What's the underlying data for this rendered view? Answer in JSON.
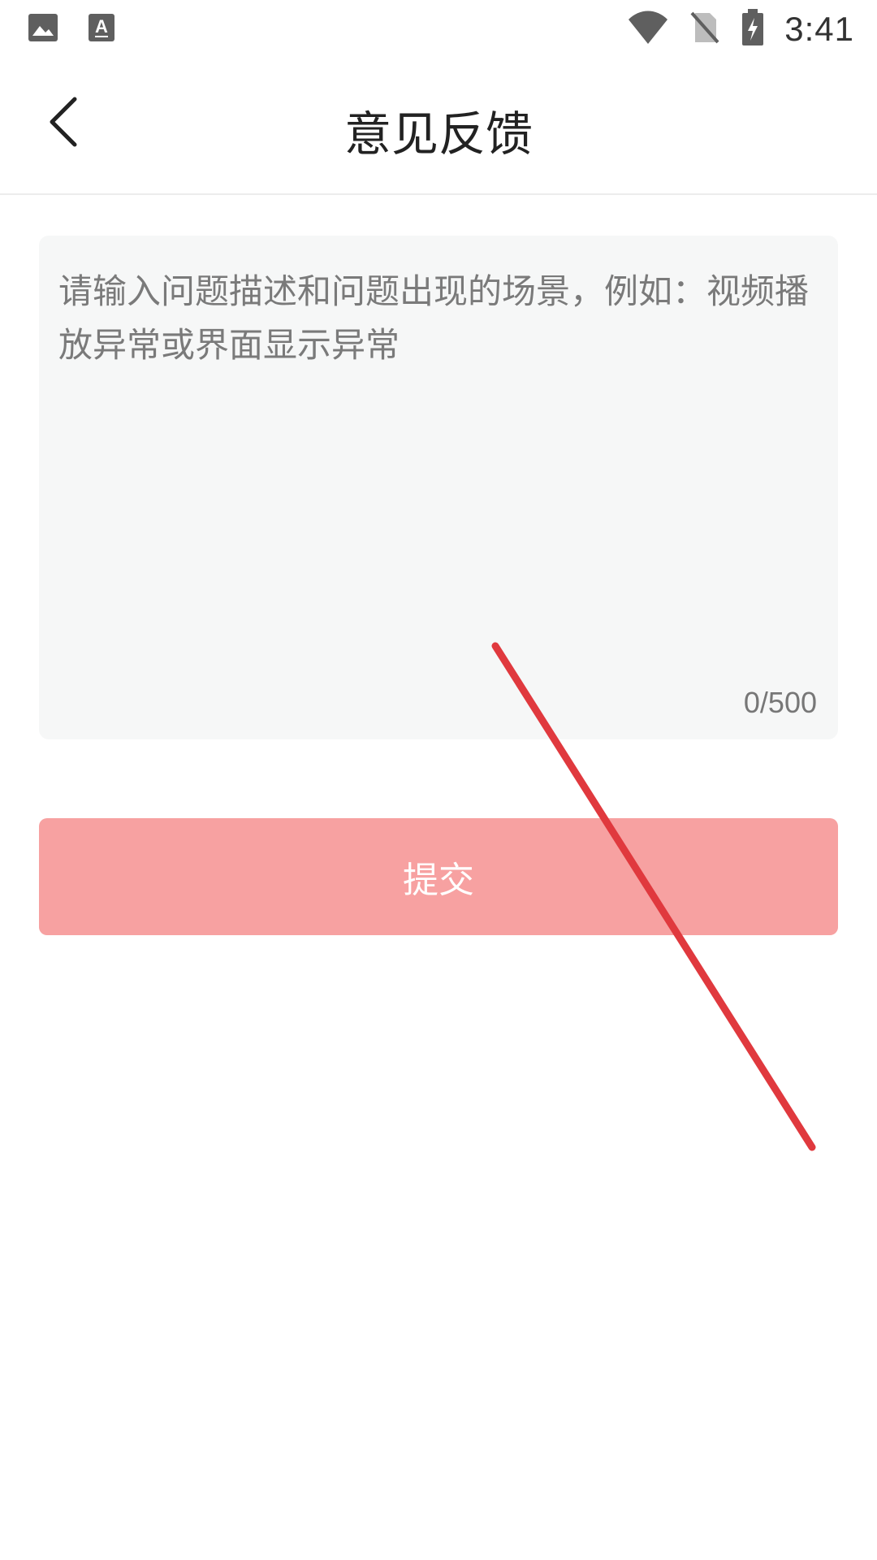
{
  "status_bar": {
    "time": "3:41",
    "icons": [
      "image-icon",
      "font-icon",
      "wifi-icon",
      "no-sim-icon",
      "battery-charging-icon"
    ]
  },
  "app_bar": {
    "title": "意见反馈",
    "back_icon": "back-arrow-icon"
  },
  "feedback": {
    "value": "",
    "placeholder": "请输入问题描述和问题出现的场景，例如：视频播放异常或界面显示异常",
    "counter": "0/500"
  },
  "submit": {
    "label": "提交",
    "color": "#f7a1a1"
  },
  "colors": {
    "annotation_line": "#e0393e"
  }
}
